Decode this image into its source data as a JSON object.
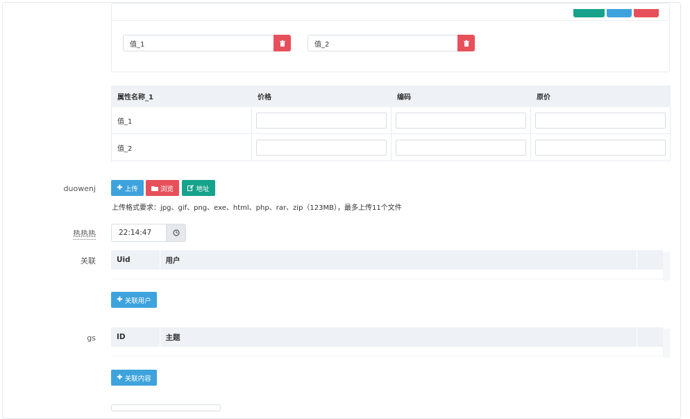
{
  "spec_panel": {
    "values": [
      {
        "value": "值_1"
      },
      {
        "value": "值_2"
      }
    ]
  },
  "spec_table": {
    "headers": [
      "属性名称_1",
      "价格",
      "编码",
      "原价"
    ],
    "rows": [
      {
        "label": "值_1"
      },
      {
        "label": "值_2"
      }
    ]
  },
  "upload": {
    "label": "duowenj",
    "upload_label": "上传",
    "browse_label": "浏览",
    "url_label": "地址",
    "help": "上传格式要求：jpg、gif、png、exe、html、php、rar、zip（123MB），最多上传11个文件"
  },
  "time_field": {
    "label": "热热热",
    "value": "22:14:47"
  },
  "relation_users": {
    "label": "关联",
    "headers": [
      "Uid",
      "用户",
      ""
    ],
    "add_label": "关联用户"
  },
  "relation_content": {
    "label": "gs",
    "headers": [
      "ID",
      "主题",
      ""
    ],
    "add_label": "关联内容"
  },
  "colors": {
    "blue": "#3ea3dc",
    "red": "#e7505a",
    "green": "#17a28b",
    "header_bg": "#eef1f5"
  }
}
